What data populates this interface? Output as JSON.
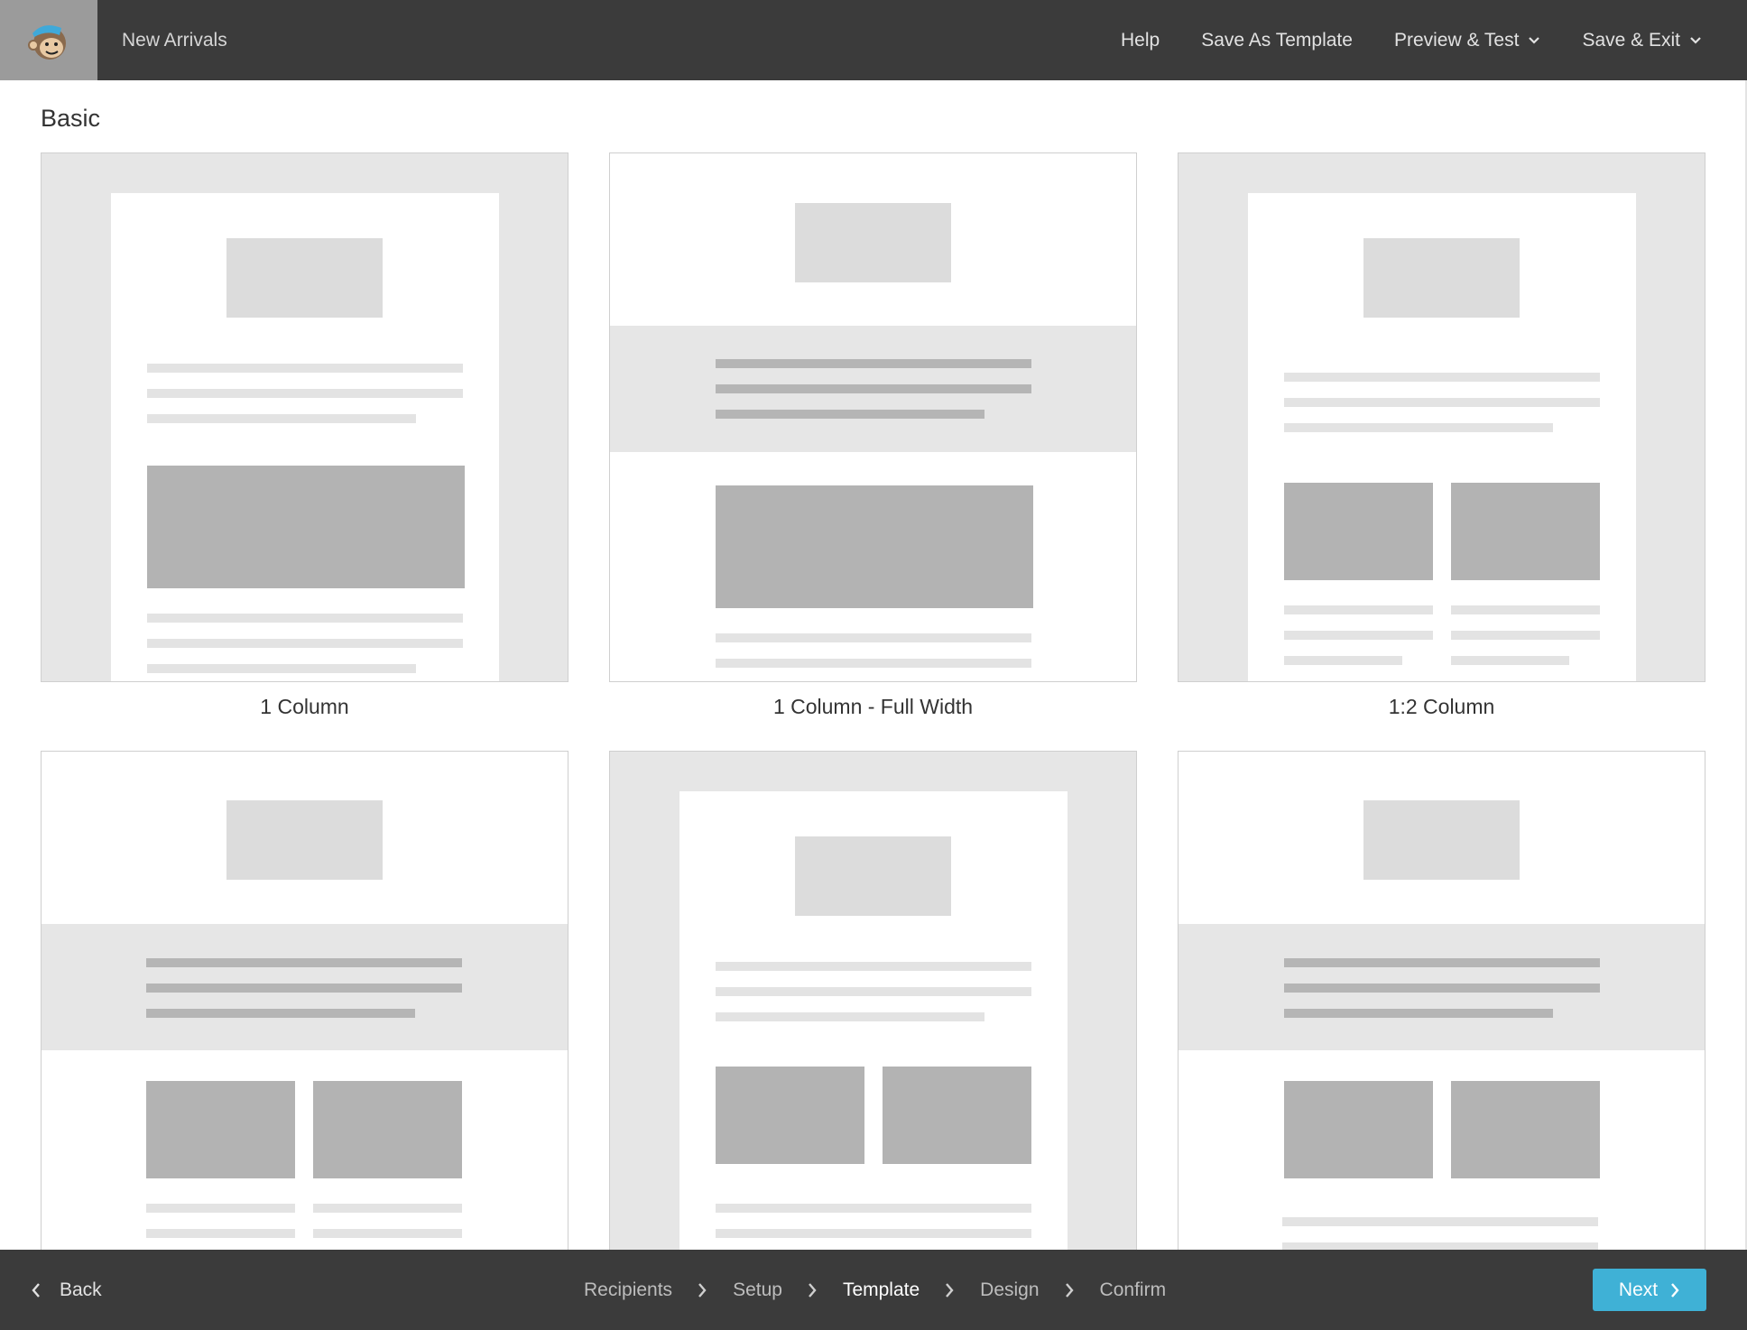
{
  "header": {
    "campaign_name": "New Arrivals",
    "nav": {
      "help": "Help",
      "save_as_template": "Save As Template",
      "preview_test": "Preview & Test",
      "save_exit": "Save & Exit"
    }
  },
  "main": {
    "section_title": "Basic",
    "templates": [
      {
        "label": "1 Column"
      },
      {
        "label": "1 Column - Full Width"
      },
      {
        "label": "1:2 Column"
      },
      {
        "label": ""
      },
      {
        "label": ""
      },
      {
        "label": ""
      }
    ]
  },
  "footer": {
    "back": "Back",
    "steps": [
      "Recipients",
      "Setup",
      "Template",
      "Design",
      "Confirm"
    ],
    "active_step": "Template",
    "next": "Next"
  },
  "colors": {
    "bar_bg": "#3b3b3b",
    "accent": "#3fb1d6",
    "placeholder_light": "#e6e6e6",
    "placeholder_dark": "#b3b3b3"
  }
}
